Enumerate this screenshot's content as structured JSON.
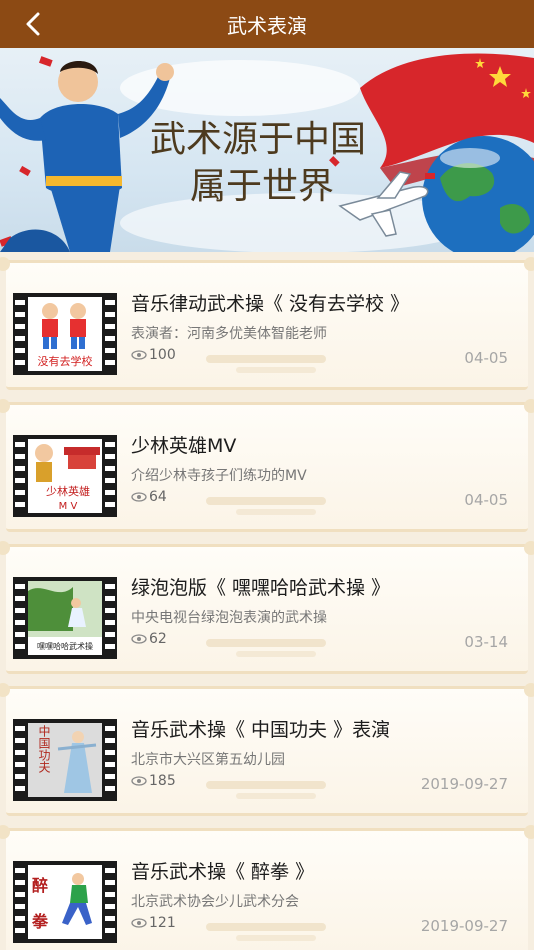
{
  "header": {
    "title": "武术表演",
    "back_icon": "back-arrow-icon"
  },
  "banner": {
    "line1": "武术源于中国",
    "line2": "属于世界"
  },
  "colors": {
    "header_bg": "#8c4a14",
    "page_bg": "#f6eee0"
  },
  "items": [
    {
      "title": "音乐律动武术操《 没有去学校 》",
      "subtitle": "表演者：河南多优美体智能老师",
      "views": "100",
      "date": "04-05",
      "thumb_text": "没有去学校"
    },
    {
      "title": "少林英雄MV",
      "subtitle": "介绍少林寺孩子们练功的MV",
      "views": "64",
      "date": "04-05",
      "thumb_text": "少林英雄",
      "thumb_text2": "M V"
    },
    {
      "title": "绿泡泡版《 嘿嘿哈哈武术操 》",
      "subtitle": "中央电视台绿泡泡表演的武术操",
      "views": "62",
      "date": "03-14",
      "thumb_text": "嘿嘿哈哈武术操"
    },
    {
      "title": "音乐武术操《 中国功夫 》表演",
      "subtitle": "北京市大兴区第五幼儿园",
      "views": "185",
      "date": "2019-09-27",
      "thumb_text": "中国功夫"
    },
    {
      "title": "音乐武术操《 醉拳 》",
      "subtitle": "北京武术协会少儿武术分会",
      "views": "121",
      "date": "2019-09-27",
      "thumb_text": "醉",
      "thumb_text2": "拳"
    }
  ]
}
